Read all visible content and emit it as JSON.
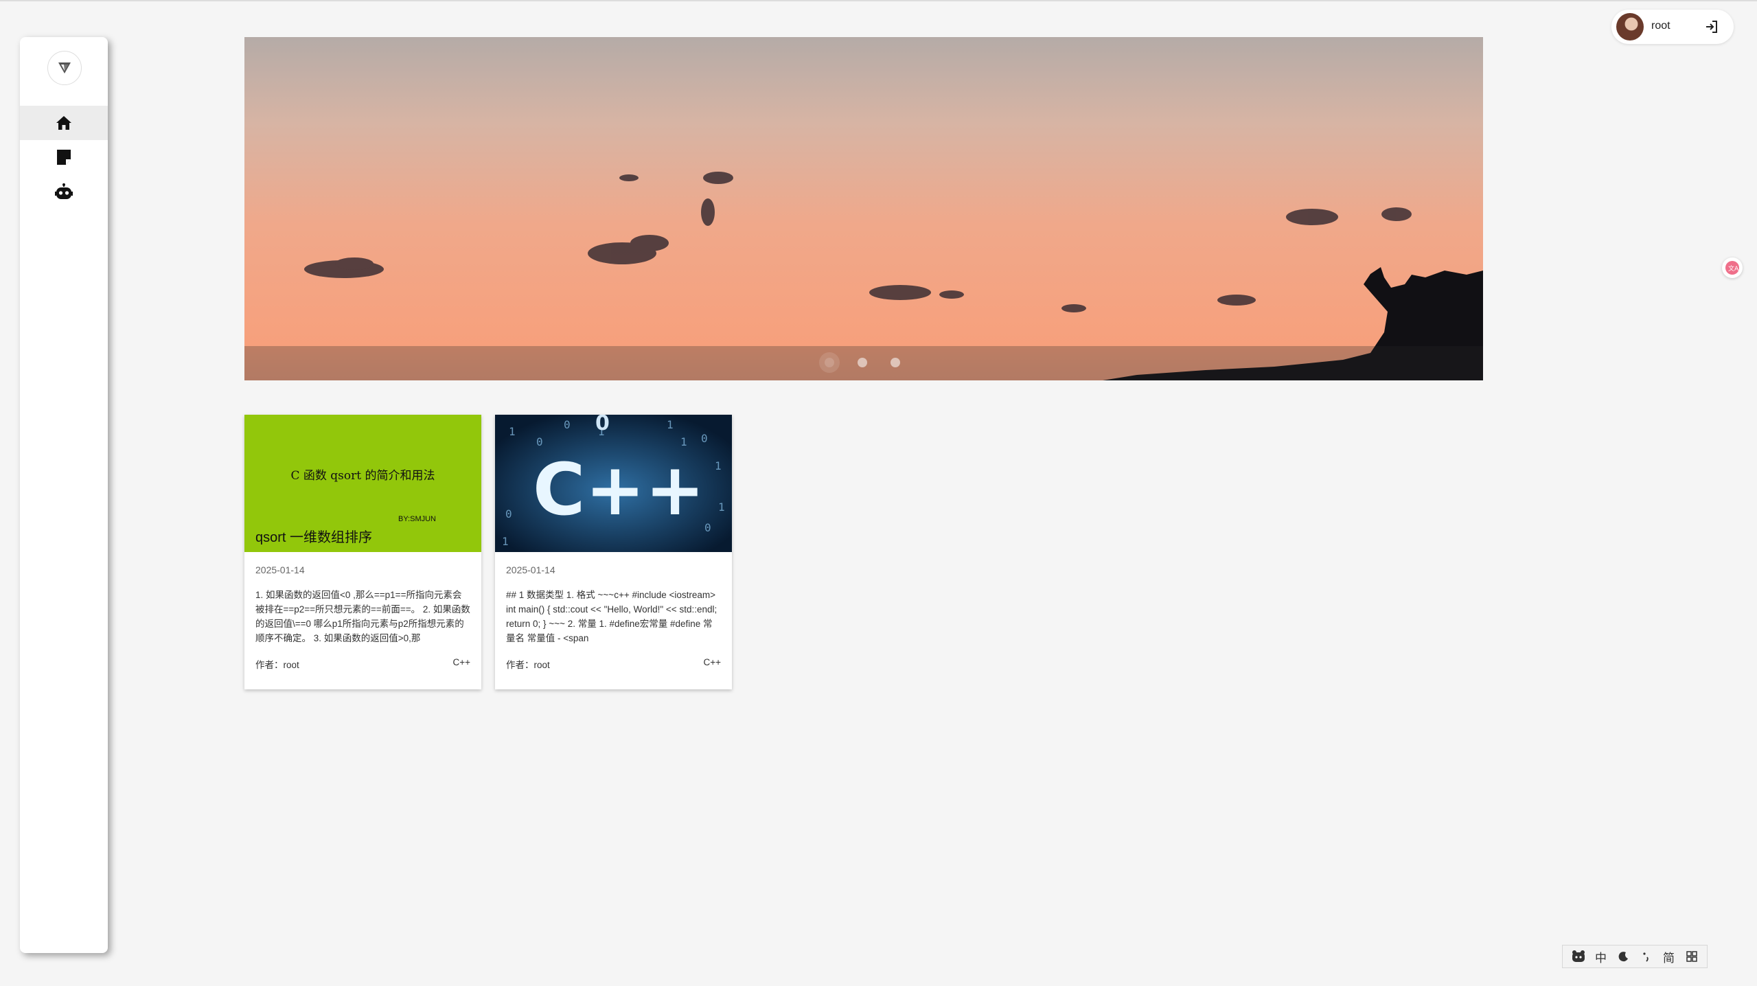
{
  "sidebar": {
    "logo_icon": "vuetify-logo-icon",
    "items": [
      {
        "icon": "home-icon",
        "active": true
      },
      {
        "icon": "article-icon",
        "active": false
      },
      {
        "icon": "robot-icon",
        "active": false
      }
    ]
  },
  "banner": {
    "slides": 3,
    "active_slide": 1
  },
  "posts": [
    {
      "cover_heading": "C 函数 qsort 的简介和用法",
      "cover_by": "BY:SMJUN",
      "cover_title": "qsort 一维数组排序",
      "date": "2025-01-14",
      "excerpt": "1. 如果函数的返回值<0 ,那么==p1==所指向元素会被排在==p2==所只想元素的==前面==。 2. 如果函数的返回值\\==0 哪么p1所指向元素与p2所指想元素的顺序不确定。 3. 如果函数的返回值>0,那",
      "author": "作者：root",
      "tag": "C++"
    },
    {
      "cover_heading": "",
      "cover_by": "",
      "cover_title": "",
      "date": "2025-01-14",
      "excerpt": "## 1 数据类型 1. 格式 ~~~c++ #include <iostream> int main() { std::cout << \"Hello, World!\" << std::endl; return 0; } ~~~ 2. 常量 1. #define宏常量 #define 常量名 常量值 - <span",
      "author": "作者：root",
      "tag": "C++"
    }
  ],
  "user": {
    "name": "root",
    "logout_icon": "logout-icon"
  },
  "ime": {
    "items": [
      "中",
      "简"
    ]
  }
}
